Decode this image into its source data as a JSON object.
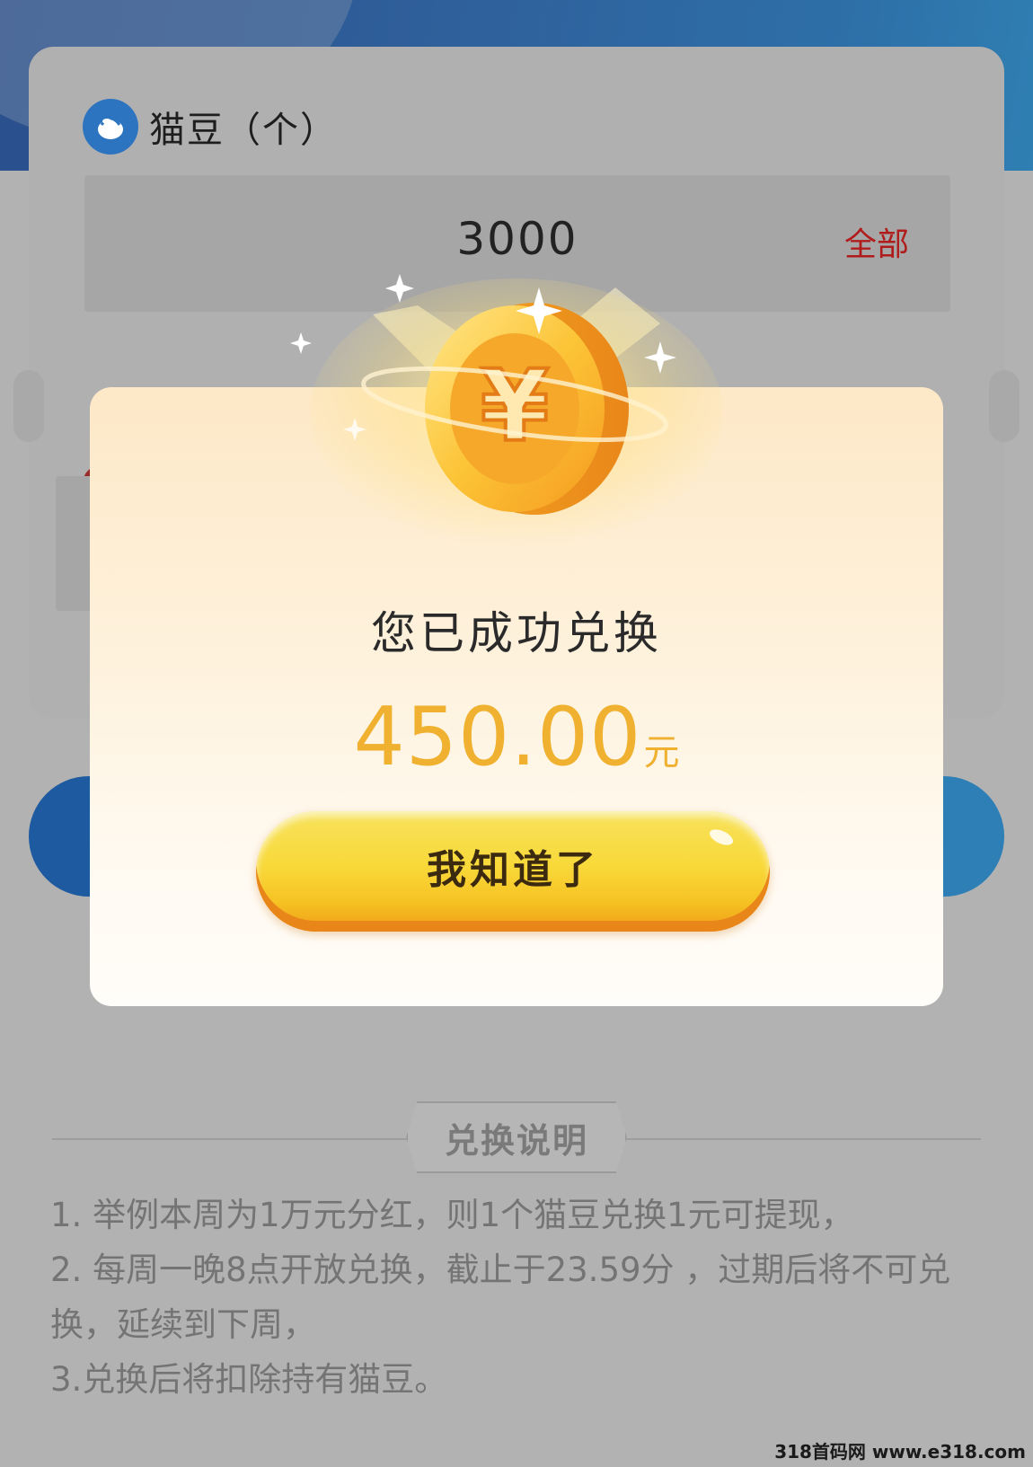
{
  "background_page": {
    "bean_label": "猫豆（个）",
    "amount_value": "3000",
    "all_label": "全部",
    "notes": {
      "title": "兑换说明",
      "lines": [
        "1. 举例本周为1万元分红，则1个猫豆兑换1元可提现，",
        "2. 每周一晚8点开放兑换，截止于23.59分 ，过期后将不可兑换，延续到下周，",
        "3.兑换后将扣除持有猫豆。"
      ]
    }
  },
  "modal": {
    "success_text": "您已成功兑换",
    "amount": "450.00",
    "unit": "元",
    "confirm_label": "我知道了",
    "coin_symbol": "¥"
  },
  "watermark": "318首码网 www.e318.com",
  "colors": {
    "header_blue": "#2f5f9a",
    "overlay_gray": "#b1b1b1",
    "amount_gold": "#efb12f",
    "button_yellow": "#f9d93a",
    "all_red": "#b01c1c"
  },
  "icons": {
    "bean": "bean-icon",
    "coin": "yuan-coin-icon",
    "sparkle": "sparkle-icon"
  }
}
